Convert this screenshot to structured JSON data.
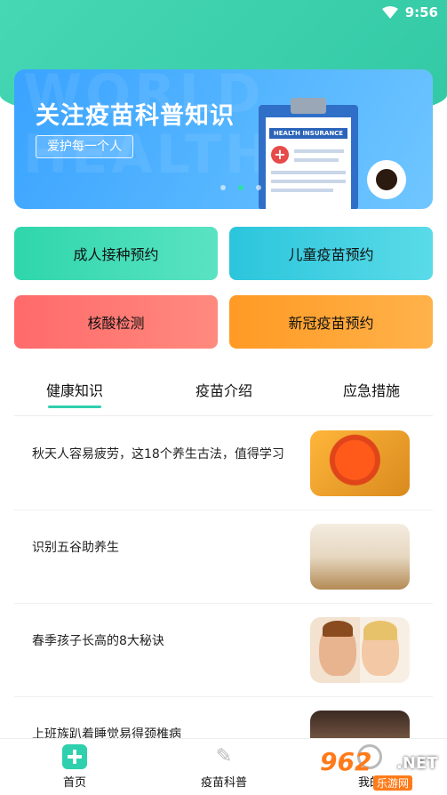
{
  "status": {
    "time": "9:56"
  },
  "banner": {
    "title": "关注疫苗科普知识",
    "subtitle": "爱护每一个人",
    "watermark_lines": [
      "WORLD",
      "HEALTH"
    ],
    "clipboard_header": "HEALTH INSURANCE"
  },
  "actions": [
    {
      "label": "成人接种预约",
      "color": "#2fd6ab"
    },
    {
      "label": "儿童疫苗预约",
      "color": "#2bc5dc"
    },
    {
      "label": "核酸检测",
      "color": "#ff6a6a"
    },
    {
      "label": "新冠疫苗预约",
      "color": "#ff9a24"
    }
  ],
  "tabs": [
    {
      "label": "健康知识",
      "active": true
    },
    {
      "label": "疫苗介绍",
      "active": false
    },
    {
      "label": "应急措施",
      "active": false
    }
  ],
  "articles": [
    {
      "title": "秋天人容易疲劳，这18个养生古法，值得学习",
      "thumb": "autumn-leaf"
    },
    {
      "title": "识别五谷助养生",
      "thumb": "wheat-field"
    },
    {
      "title": "春季孩子长高的8大秘诀",
      "thumb": "two-kids"
    },
    {
      "title": "上班族趴着睡觉易得颈椎病",
      "thumb": "neck-pain"
    }
  ],
  "bottom_nav": [
    {
      "label": "首页",
      "icon": "home-plus-icon",
      "active": true
    },
    {
      "label": "疫苗科普",
      "icon": "syringe-icon",
      "active": false
    },
    {
      "label": "我的",
      "icon": "user-icon",
      "active": false
    }
  ],
  "watermark": {
    "logo": "962",
    "net": ".NET",
    "sub": "乐游网"
  },
  "colors": {
    "accent": "#2fcfae",
    "header_bg": "#46d7b4",
    "banner_bg": "#3aa3ff"
  }
}
